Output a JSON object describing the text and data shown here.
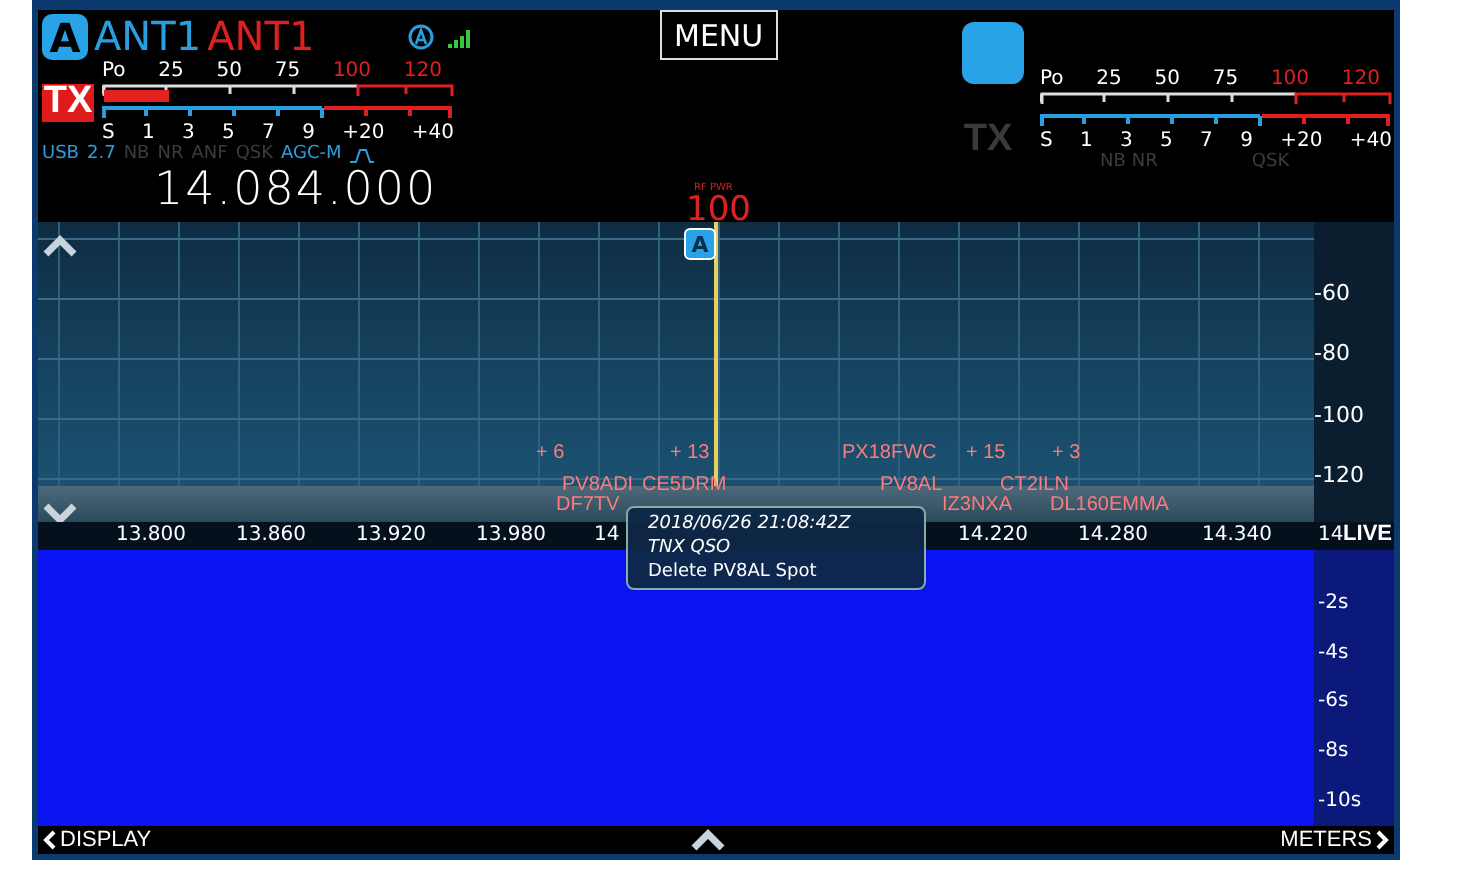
{
  "vfo_a": {
    "badge": "A",
    "antenna_rx": "ANT1",
    "antenna_tx": "ANT1",
    "tx_badge": "TX",
    "tx_active": true,
    "po_scale": [
      "Po",
      "25",
      "50",
      "75",
      "100",
      "120"
    ],
    "po_meter": {
      "level": 0.25
    },
    "s_scale": [
      "S",
      "1",
      "3",
      "5",
      "7",
      "9",
      "+20",
      "+40"
    ],
    "mode": "USB",
    "bandwidth": "2.7",
    "flags": [
      {
        "label": "NB",
        "on": false
      },
      {
        "label": "NR",
        "on": false
      },
      {
        "label": "ANF",
        "on": false
      },
      {
        "label": "QSK",
        "on": false
      },
      {
        "label": "AGC-M",
        "on": true
      }
    ],
    "frequency": "14.084.000"
  },
  "menu_button": "MENU",
  "rf_power": {
    "label": "RF PWR",
    "value": "100"
  },
  "vfo_b": {
    "tx_badge": "TX",
    "tx_active": false,
    "po_scale": [
      "Po",
      "25",
      "50",
      "75",
      "100",
      "120"
    ],
    "s_scale": [
      "S",
      "1",
      "3",
      "5",
      "7",
      "9",
      "+20",
      "+40"
    ],
    "flags": [
      {
        "label": "NB",
        "on": false
      },
      {
        "label": "NR",
        "on": false
      },
      {
        "label": "QSK",
        "on": false
      }
    ]
  },
  "spectrum": {
    "marker_badge": "A",
    "db_scale": [
      "-60",
      "-80",
      "-100",
      "-120"
    ],
    "spots": [
      {
        "text": "+ 6"
      },
      {
        "text": "+ 13"
      },
      {
        "text": "PX18FWC"
      },
      {
        "text": "+ 15"
      },
      {
        "text": "+ 3"
      },
      {
        "text": "PV8ADI"
      },
      {
        "text": "CE5DRM"
      },
      {
        "text": "PV8AL"
      },
      {
        "text": "CT2ILN"
      },
      {
        "text": "DF7TV"
      },
      {
        "text": "IZ3NXA"
      },
      {
        "text": "DL160EMMA"
      }
    ],
    "freq_axis": [
      "13.800",
      "13.860",
      "13.920",
      "13.980",
      "14",
      "14.220",
      "14.280",
      "14.340",
      "14"
    ],
    "live_label": "LIVE"
  },
  "spot_popup": {
    "timestamp": "2018/06/26 21:08:42Z",
    "comment": "TNX QSO",
    "action": "Delete PV8AL Spot"
  },
  "waterfall": {
    "time_scale": [
      "-2s",
      "-4s",
      "-6s",
      "-8s",
      "-10s"
    ]
  },
  "bottom_bar": {
    "left": "DISPLAY",
    "right": "METERS"
  }
}
